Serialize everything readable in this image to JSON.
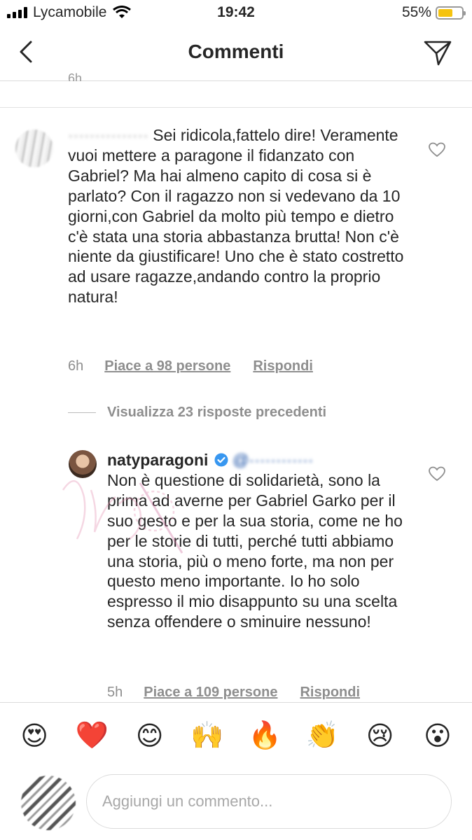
{
  "status_bar": {
    "carrier": "Lycamobile",
    "time": "19:42",
    "battery": "55%",
    "battery_level": 0.55
  },
  "nav": {
    "title": "Commenti",
    "back_icon": "chevron-left-icon",
    "send_icon": "paper-plane-icon"
  },
  "previous_time": "6h",
  "comment1": {
    "text": "Sei ridicola,fattelo dire! Veramente vuoi mettere a paragone il fidanzato con Gabriel? Ma hai almeno capito di cosa si è parlato? Con il ragazzo non si vedevano da 10 giorni,con Gabriel da molto più tempo e dietro c'è stata una storia abbastanza brutta! Non c'è niente da giustificare! Uno che è stato costretto ad usare ragazze,andando contro la proprio natura!",
    "time": "6h",
    "likes": "Piace a 98 persone",
    "reply": "Rispondi"
  },
  "view_previous": "Visualizza 23 risposte precedenti",
  "comment2": {
    "username": "natyparagoni",
    "text": "Non è questione di solidarietà, sono la prima ad averne per Gabriel Garko per il suo gesto e per la sua storia, come ne ho per le storie di tutti, perché tutti abbiamo una storia, più o meno forte, ma non per questo meno importante. Io ho solo espresso il mio disappunto su una scelta senza offendere o sminuire nessuno!",
    "time": "5h",
    "likes": "Piace a 109 persone",
    "reply": "Rispondi"
  },
  "emoji_bar": [
    "😍",
    "❤️",
    "😊",
    "🙌",
    "🔥",
    "👏",
    "😢",
    "😮"
  ],
  "input": {
    "placeholder": "Aggiungi un commento..."
  },
  "colors": {
    "verified": "#3897f0",
    "muted": "#8e8e8e",
    "separator": "#dbdbdb"
  }
}
